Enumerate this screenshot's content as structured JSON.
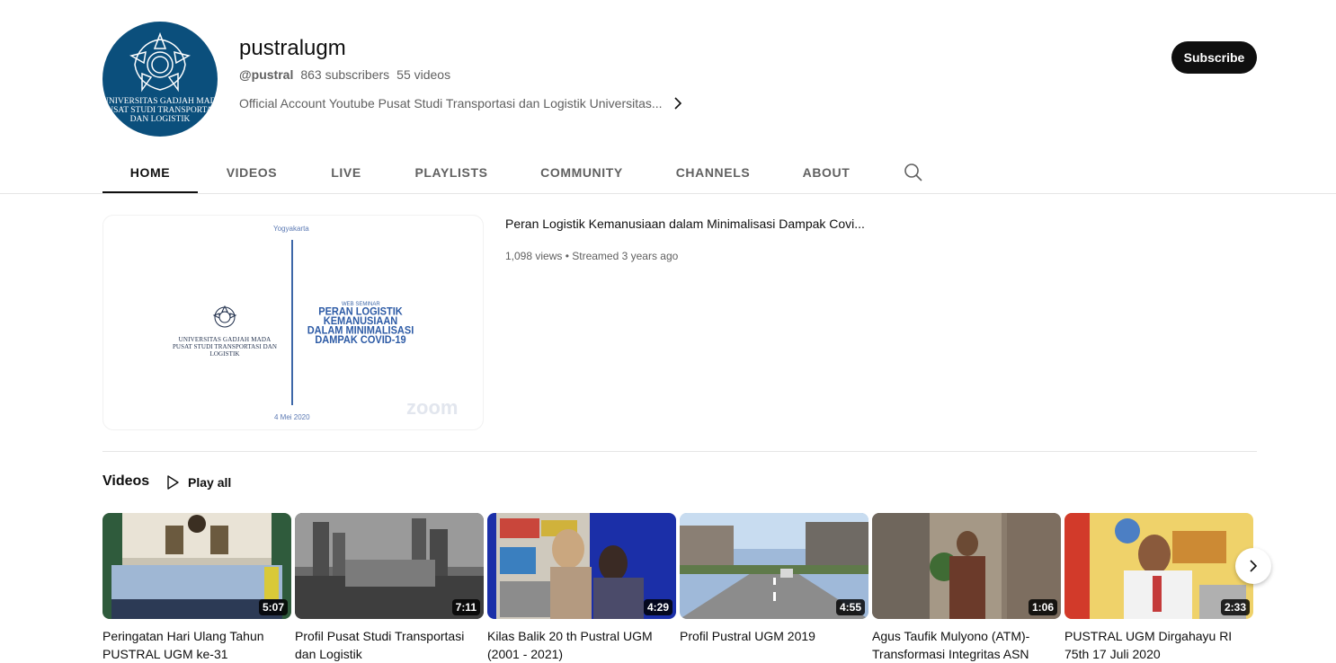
{
  "channel": {
    "name": "pustralugm",
    "handle": "@pustral",
    "subscribers": "863 subscribers",
    "videos_count": "55 videos",
    "description": "Official Account Youtube Pusat Studi Transportasi dan Logistik Universitas...",
    "subscribe_label": "Subscribe",
    "avatar_text": [
      "UNIVERSITAS GADJAH MADA",
      "PUSAT STUDI TRANSPORTASI",
      "DAN LOGISTIK"
    ],
    "brand_color": "#0b4f7c"
  },
  "tabs": [
    {
      "label": "HOME",
      "active": true
    },
    {
      "label": "VIDEOS",
      "active": false
    },
    {
      "label": "LIVE",
      "active": false
    },
    {
      "label": "PLAYLISTS",
      "active": false
    },
    {
      "label": "COMMUNITY",
      "active": false
    },
    {
      "label": "CHANNELS",
      "active": false
    },
    {
      "label": "ABOUT",
      "active": false
    }
  ],
  "featured": {
    "title": "Peran Logistik Kemanusiaan dalam Minimalisasi Dampak Covi...",
    "meta": "1,098 views • Streamed 3 years ago",
    "thumb": {
      "city": "Yogyakarta",
      "date": "4 Mei 2020",
      "univ_line1": "UNIVERSITAS GADJAH MADA",
      "univ_line2": "PUSAT STUDI TRANSPORTASI DAN LOGISTIK",
      "web_seminar": "WEB SEMINAR",
      "title_lines": [
        "PERAN LOGISTIK KEMANUSIAAN",
        "DALAM MINIMALISASI",
        "DAMPAK COVID-19"
      ],
      "zoom": "zoom"
    }
  },
  "shelf": {
    "title": "Videos",
    "play_all": "Play all",
    "videos": [
      {
        "title": "Peringatan Hari Ulang Tahun PUSTRAL UGM ke-31",
        "duration": "5:07"
      },
      {
        "title": "Profil Pusat Studi Transportasi dan Logistik",
        "duration": "7:11"
      },
      {
        "title": "Kilas Balik 20 th Pustral UGM (2001 - 2021)",
        "duration": "4:29"
      },
      {
        "title": "Profil Pustral UGM 2019",
        "duration": "4:55"
      },
      {
        "title": "Agus Taufik Mulyono (ATM)- Transformasi Integritas ASN",
        "duration": "1:06"
      },
      {
        "title": "PUSTRAL UGM Dirgahayu RI 75th 17 Juli 2020",
        "duration": "2:33"
      }
    ]
  },
  "icons": {
    "search": "search-icon",
    "chevron": "chevron-right-icon",
    "play": "play-outline-icon",
    "next": "chevron-right-icon"
  }
}
